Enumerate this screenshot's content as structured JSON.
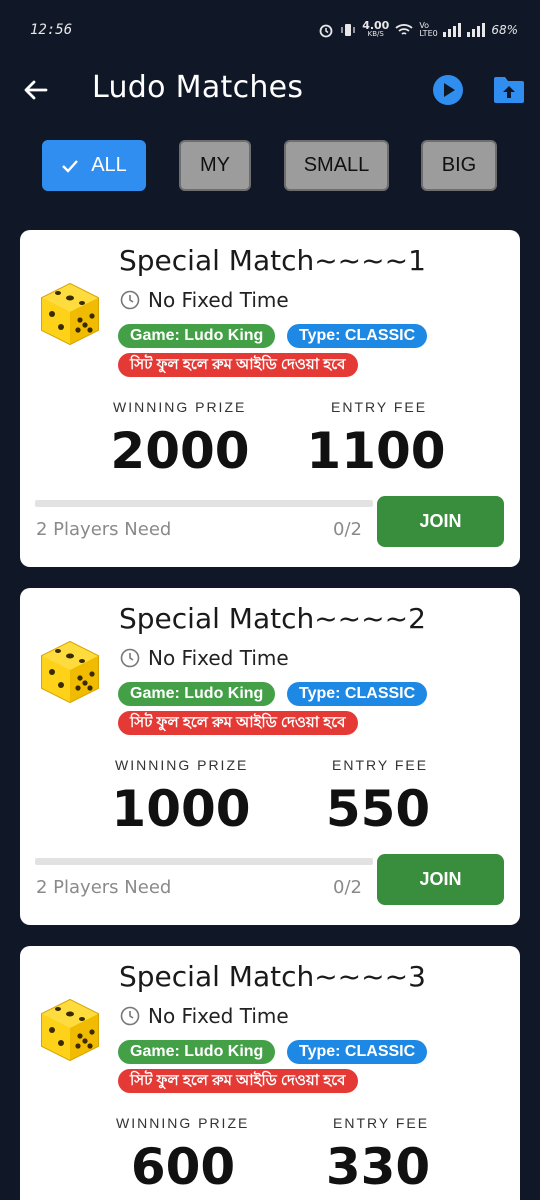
{
  "status_bar": {
    "time": "12:56",
    "net_speed": "4.00",
    "net_unit": "KB/S",
    "volte": "Vo LTE0",
    "battery": "68%"
  },
  "app_bar": {
    "title": "Ludo Matches",
    "icons": [
      "back-arrow-icon",
      "play-icon",
      "folder-upload-icon"
    ]
  },
  "filters": [
    {
      "label": "ALL",
      "active": true
    },
    {
      "label": "MY",
      "active": false
    },
    {
      "label": "SMALL",
      "active": false
    },
    {
      "label": "BIG",
      "active": false
    }
  ],
  "colors": {
    "background": "#101827",
    "accent_blue": "#2f8ef0",
    "game_tag": "#43a047",
    "type_tag": "#1e88e5",
    "note_tag": "#e53935",
    "join_button": "#388e3c"
  },
  "labels": {
    "winning_prize": "WINNING PRIZE",
    "entry_fee": "ENTRY FEE",
    "join": "JOIN"
  },
  "matches": [
    {
      "title": "Special Match~~~~1",
      "time": "No Fixed Time",
      "game_tag": "Game: Ludo King",
      "type_tag": "Type: CLASSIC",
      "note": "সিট ফুল হলে রুম আইডি দেওয়া হবে",
      "winning_prize": "2000",
      "entry_fee": "1100",
      "players_need": "2 Players Need",
      "players_count": "0/2",
      "progress": 0
    },
    {
      "title": "Special Match~~~~2",
      "time": "No Fixed Time",
      "game_tag": "Game: Ludo King",
      "type_tag": "Type: CLASSIC",
      "note": "সিট ফুল হলে রুম আইডি দেওয়া হবে",
      "winning_prize": "1000",
      "entry_fee": "550",
      "players_need": "2 Players Need",
      "players_count": "0/2",
      "progress": 0
    },
    {
      "title": "Special Match~~~~3",
      "time": "No Fixed Time",
      "game_tag": "Game: Ludo King",
      "type_tag": "Type: CLASSIC",
      "note": "সিট ফুল হলে রুম আইডি দেওয়া হবে",
      "winning_prize": "600",
      "entry_fee": "330"
    }
  ]
}
